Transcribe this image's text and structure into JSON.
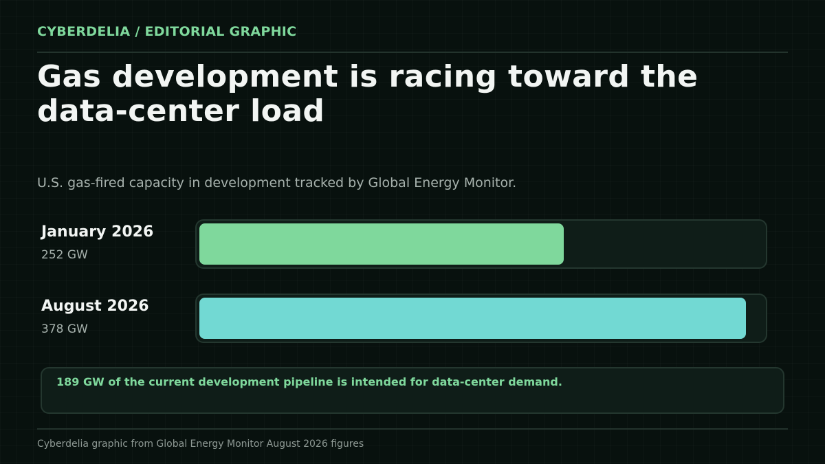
{
  "kicker": "CYBERDELIA / EDITORIAL GRAPHIC",
  "headline": "Gas development is racing toward the data-center load",
  "subtitle": "U.S. gas-fired capacity in development tracked by Global Energy Monitor.",
  "callout": "189 GW of the current development pipeline is intended for data-center demand.",
  "source": "Cyberdelia graphic from Global Energy Monitor August 2026 figures",
  "colors": {
    "accent": "#7fd89c",
    "bar_jan": "#7fd89c",
    "bar_aug": "#72d9d3",
    "background": "#08110e",
    "track": "#0f1d18"
  },
  "chart_data": {
    "type": "bar",
    "orientation": "horizontal",
    "categories": [
      "January 2026",
      "August 2026"
    ],
    "values": [
      252,
      378
    ],
    "value_labels": [
      "252 GW",
      "378 GW"
    ],
    "unit": "GW",
    "xlim": [
      0,
      390
    ],
    "title": "Gas development is racing toward the data-center load",
    "subtitle": "U.S. gas-fired capacity in development tracked by Global Energy Monitor.",
    "grid": false,
    "legend": "none"
  }
}
